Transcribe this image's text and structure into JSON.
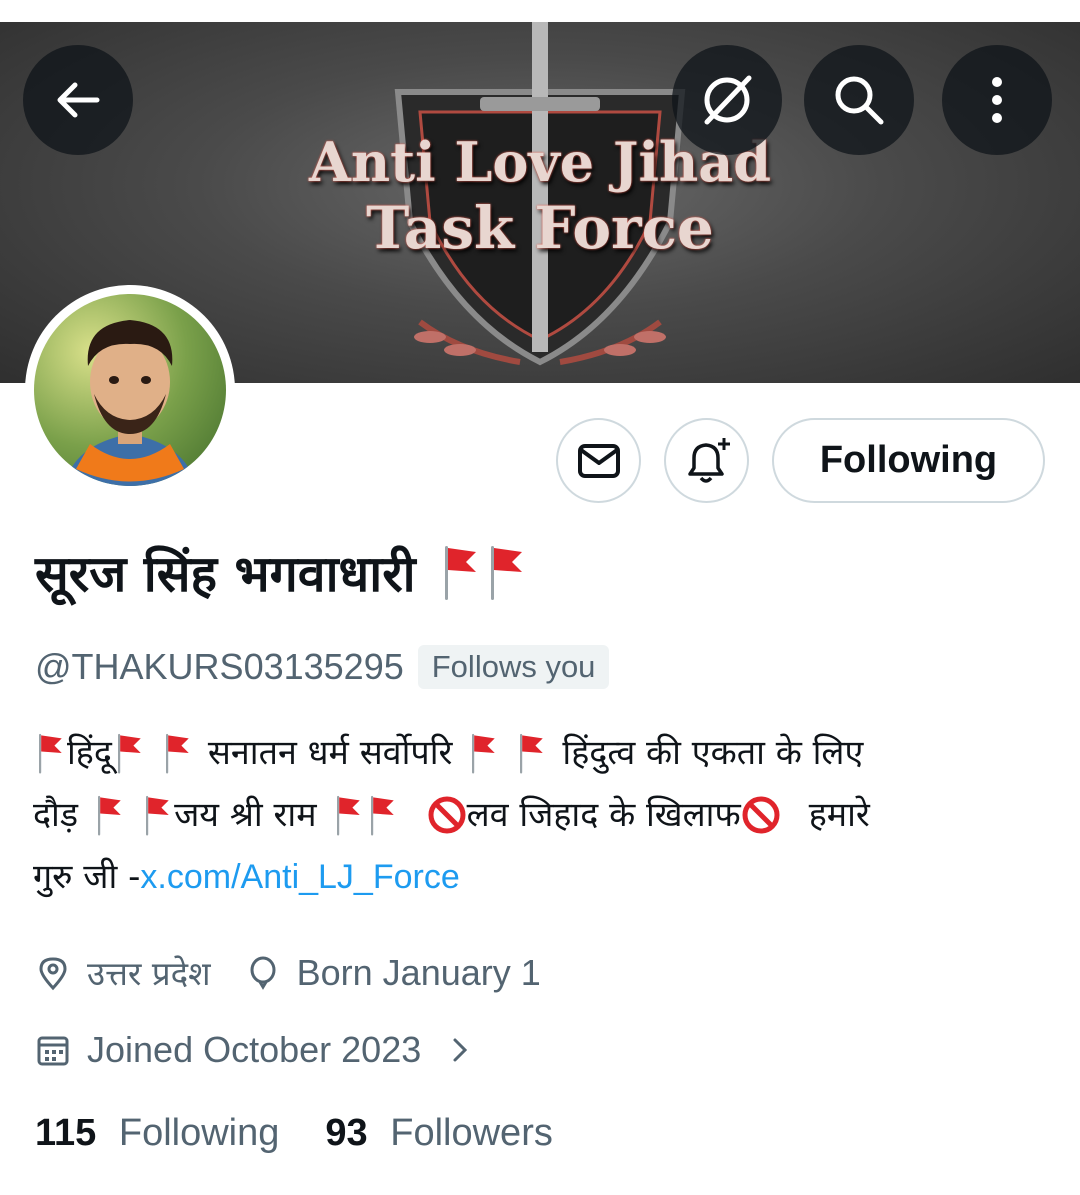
{
  "banner": {
    "line1": "Anti Love Jihad",
    "line2": "Task Force"
  },
  "topbar": {
    "back_icon": "arrow-left-icon",
    "grok_icon": "slashed-circle-icon",
    "search_icon": "search-icon",
    "more_icon": "vertical-dots-icon"
  },
  "actions": {
    "message_icon": "envelope-icon",
    "notify_icon": "bell-plus-icon",
    "follow_label": "Following"
  },
  "profile": {
    "name": "सूरज सिंह भगवाधारी",
    "name_emoji": "🚩🚩",
    "handle": "@THAKURS03135295",
    "follows_you": "Follows you"
  },
  "bio": {
    "line1": {
      "a": "हिंदू",
      "b": "सनातन धर्म सर्वोपरि",
      "c": "हिंदुत्व की एकता के लिए"
    },
    "line2": {
      "a": "दौड़",
      "b": "जय श्री राम",
      "c": "लव जिहाद के खिलाफ",
      "d": "हमारे"
    },
    "line3": {
      "prefix": "गुरु जी -",
      "link": "x.com/Anti_LJ_Force"
    }
  },
  "meta": {
    "location": "उत्तर प्रदेश",
    "birthday": "Born January 1",
    "joined": "Joined October 2023"
  },
  "stats": {
    "following_count": "115",
    "following_label": "Following",
    "followers_count": "93",
    "followers_label": "Followers"
  },
  "colors": {
    "accent": "#1d9bf0",
    "secondary_text": "#536471",
    "border": "#cfd9de",
    "flag_red": "#e0242b"
  }
}
